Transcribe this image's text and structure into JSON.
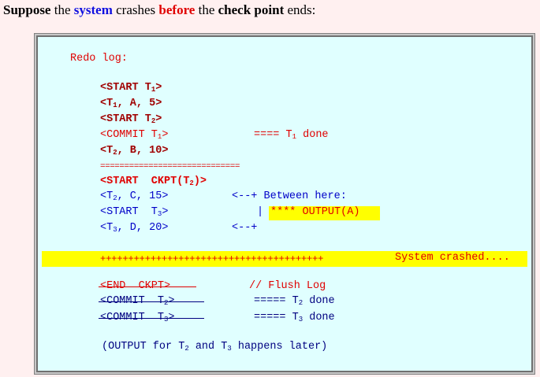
{
  "heading": {
    "w1": "Suppose",
    "w2": " the ",
    "w3": "system",
    "w4": " crashes ",
    "w5": "before",
    "w6": " the ",
    "w7": "check point",
    "w8": " ends:"
  },
  "log": {
    "title": "Redo log:",
    "lines": {
      "l1_pre": "<START T",
      "l1_sub": "1",
      "l1_post": ">",
      "l2_pre": "<T",
      "l2_sub": "1",
      "l2_post": ", A, 5>",
      "l3_pre": "<START T",
      "l3_sub": "2",
      "l3_post": ">",
      "l4_pre": "<COMMIT T",
      "l4_sub": "1",
      "l4_post": ">",
      "l4_note_pre": "==== T",
      "l4_note_sub": "1",
      "l4_note_post": " done",
      "l5_pre": "<T",
      "l5_sub": "2",
      "l5_post": ", B, 10>",
      "sep": "=============================",
      "ckpt_pre": "<START  CKPT(T",
      "ckpt_sub": "2",
      "ckpt_post": ")>",
      "l6_pre": "<T",
      "l6_sub": "2",
      "l6_post": ", C, 15>",
      "l6_note": "<--+ Between here:",
      "l7_pre": "<START  T",
      "l7_sub": "3",
      "l7_post": ">",
      "l7_bar": "|",
      "l7_output": "**** OUTPUT(A)",
      "l8_pre": "<T",
      "l8_sub": "3",
      "l8_post": ", D, 20>",
      "l8_note": "<--+"
    },
    "crash": {
      "plus": "++++++++++++++++++++++++++++++++++++++++",
      "label": "System crashed...."
    },
    "after": {
      "end_ckpt": "<END  CKPT>",
      "flush": "// Flush Log",
      "c2_pre": "<COMMIT  T",
      "c2_sub": "2",
      "c2_post": ">",
      "c2_note_pre": "===== T",
      "c2_note_sub": "2",
      "c2_note_post": " done",
      "c3_pre": "<COMMIT  T",
      "c3_sub": "3",
      "c3_post": ">",
      "c3_note_pre": "===== T",
      "c3_note_sub": "3",
      "c3_note_post": " done"
    },
    "footer": {
      "pre": "(OUTPUT for T",
      "sub1": "2",
      "mid": " and T",
      "sub2": "3",
      "post": " happens later)"
    }
  }
}
